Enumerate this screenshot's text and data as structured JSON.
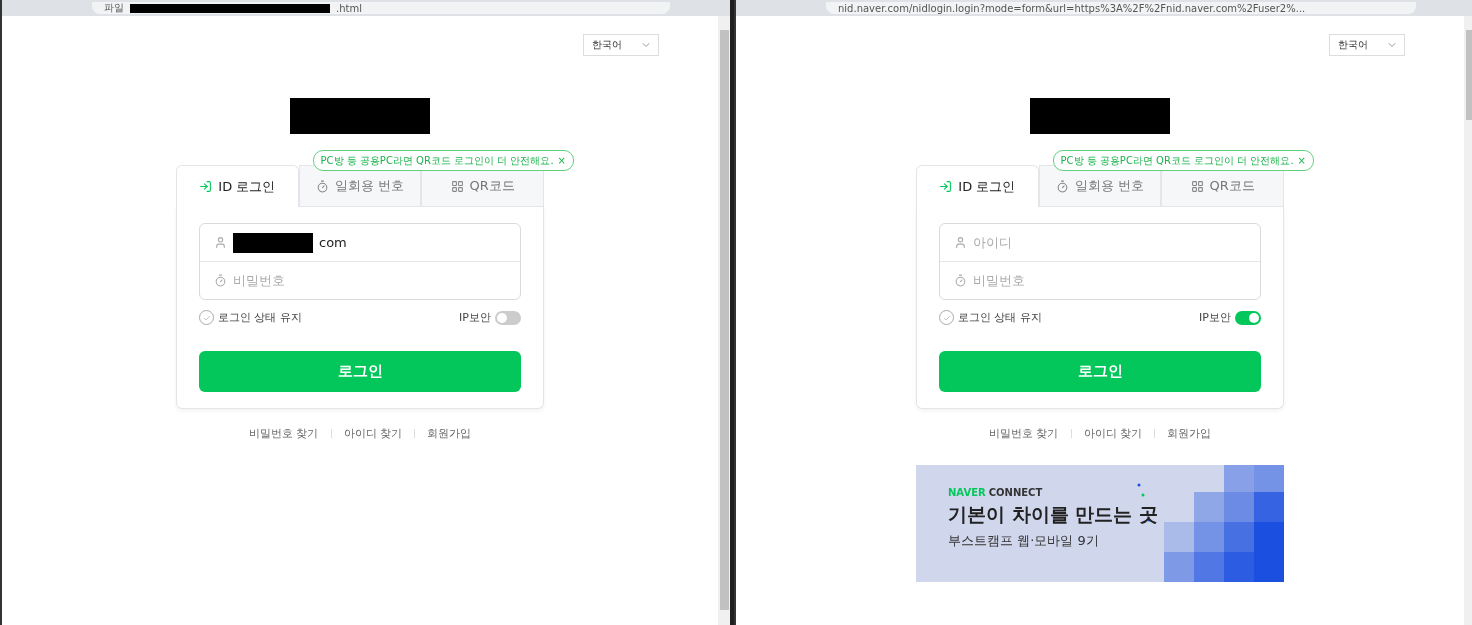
{
  "windows": [
    {
      "address": {
        "prefix": "파일",
        "text": ".html",
        "redacted": true
      },
      "language": "한국어",
      "logo_redacted": true,
      "tooltip": {
        "text": "PC방 등 공용PC라면 QR코드 로그인이 더 안전해요.",
        "close": "×"
      },
      "tabs": [
        {
          "label": "ID 로그인",
          "selected": true
        },
        {
          "label": "일회용 번호",
          "selected": false
        },
        {
          "label": "QR코드",
          "selected": false
        }
      ],
      "id_field": {
        "value": "com",
        "redacted": true
      },
      "password_field": {
        "placeholder": "비밀번호"
      },
      "keep_login": {
        "label": "로그인 상태 유지",
        "checked": false
      },
      "ip_security": {
        "label": "IP보안",
        "on": false
      },
      "login_button": "로그인",
      "links": [
        "비밀번호 찾기",
        "아이디 찾기",
        "회원가입"
      ]
    },
    {
      "address": {
        "text": "nid.naver.com/nidlogin.login?mode=form&url=https%3A%2F%2Fnid.naver.com%2Fuser2%...",
        "redacted": false
      },
      "language": "한국어",
      "logo_redacted": true,
      "tooltip": {
        "text": "PC방 등 공용PC라면 QR코드 로그인이 더 안전해요.",
        "close": "×"
      },
      "tabs": [
        {
          "label": "ID 로그인",
          "selected": true
        },
        {
          "label": "일회용 번호",
          "selected": false
        },
        {
          "label": "QR코드",
          "selected": false
        }
      ],
      "id_field": {
        "placeholder": "아이디",
        "redacted": false
      },
      "password_field": {
        "placeholder": "비밀번호"
      },
      "keep_login": {
        "label": "로그인 상태 유지",
        "checked": false
      },
      "ip_security": {
        "label": "IP보안",
        "on": true
      },
      "login_button": "로그인",
      "links": [
        "비밀번호 찾기",
        "아이디 찾기",
        "회원가입"
      ],
      "banner": {
        "brand": [
          "NAVER",
          "CONNECT"
        ],
        "headline": "기본이 차이를 만드는 곳",
        "subline": "부스트캠프 웹·모바일 9기"
      }
    }
  ]
}
